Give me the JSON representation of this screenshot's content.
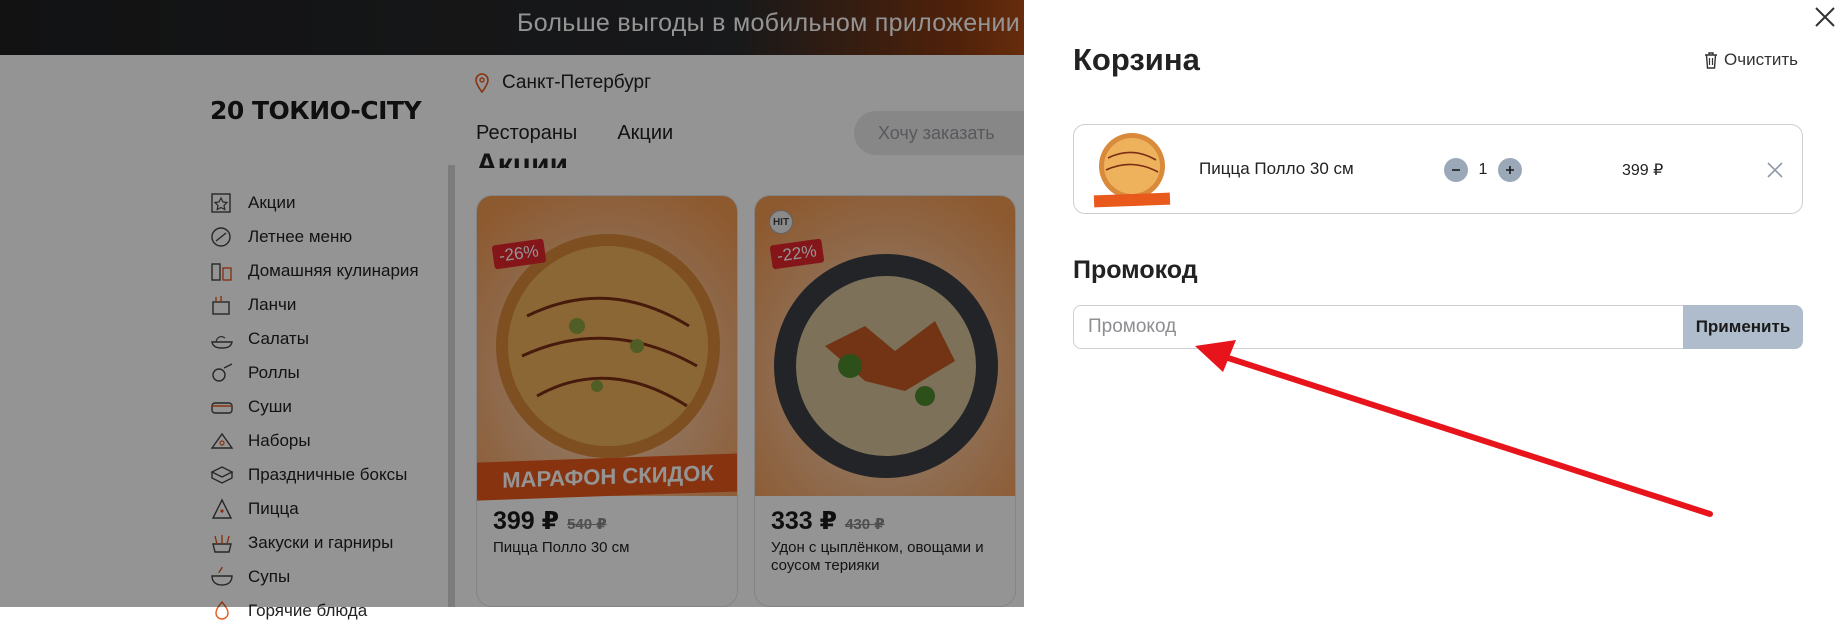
{
  "banner": {
    "text": "Больше выгоды в мобильном приложении"
  },
  "site": {
    "logo": "20 ТОКИО-CITY",
    "city": "Санкт-Петербург"
  },
  "nav": {
    "items": [
      "Рестораны",
      "Акции"
    ],
    "search_placeholder": "Хочу заказать"
  },
  "section_title": "Акции",
  "categories": [
    "Акции",
    "Летнее меню",
    "Домашняя кулинария",
    "Ланчи",
    "Салаты",
    "Роллы",
    "Суши",
    "Наборы",
    "Праздничные боксы",
    "Пицца",
    "Закуски и гарниры",
    "Супы",
    "Горячие блюда"
  ],
  "products": [
    {
      "discount": "-26%",
      "banner": "МАРАФОН СКИДОК",
      "price": "399 ₽",
      "old_price": "540 ₽",
      "name": "Пицца Полло 30 см"
    },
    {
      "badge": "HIT",
      "discount": "-22%",
      "price": "333 ₽",
      "old_price": "430 ₽",
      "name": "Удон с цыплёнком, овощами и соусом терияки"
    }
  ],
  "cart": {
    "title": "Корзина",
    "clear_label": "Очистить",
    "items": [
      {
        "name": "Пицца Полло 30 см",
        "qty": "1",
        "price": "399 ₽",
        "image_label": "МАРАФОН СКИДОК"
      }
    ],
    "promo_title": "Промокод",
    "promo_placeholder": "Промокод",
    "promo_value": "",
    "apply_label": "Применить"
  },
  "colors": {
    "accent": "#e9591c",
    "apply_button": "#aebccb",
    "annotation_arrow": "#e8141b"
  }
}
